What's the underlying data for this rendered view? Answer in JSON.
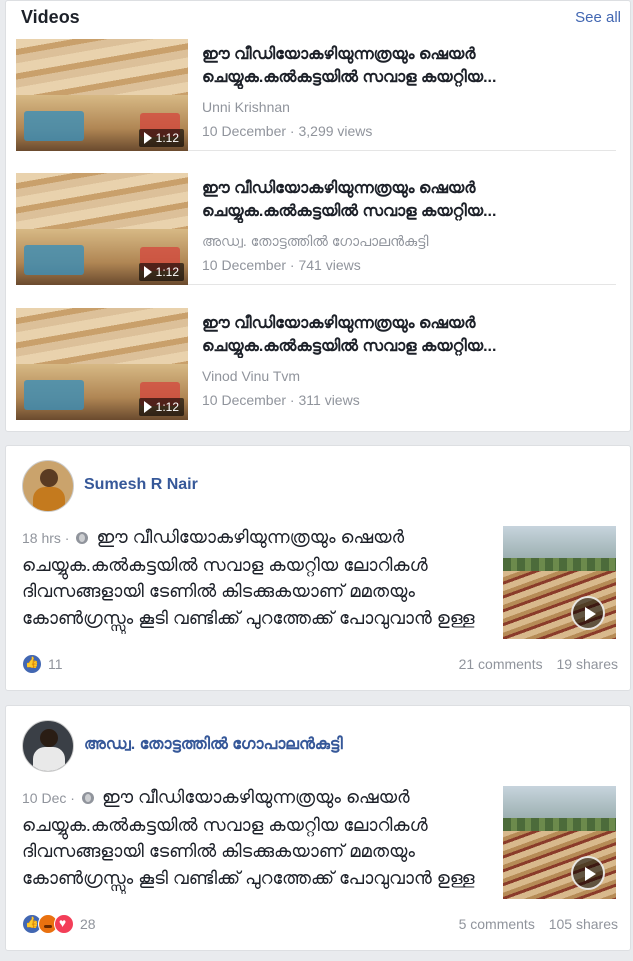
{
  "videos": {
    "title": "Videos",
    "see_all": "See all",
    "items": [
      {
        "title": "ഈ വീഡിയോകഴിയുന്നത്രയും ഷെയർ ചെയ്യുക.കൽകട്ടയിൽ സവാള കയറ്റിയ...",
        "author": "Unni Krishnan",
        "meta": "10 December · 3,299 views",
        "duration": "1:12"
      },
      {
        "title": "ഈ വീഡിയോകഴിയുന്നത്രയും ഷെയർ ചെയ്യുക.കൽകട്ടയിൽ സവാള കയറ്റിയ...",
        "author": "അഡ്വ. തോട്ടത്തിൽ ഗോപാലൻകുട്ടി",
        "meta": "10 December · 741 views",
        "duration": "1:12"
      },
      {
        "title": "ഈ വീഡിയോകഴിയുന്നത്രയും ഷെയർ ചെയ്യുക.കൽകട്ടയിൽ സവാള കയറ്റിയ...",
        "author": "Vinod Vinu Tvm",
        "meta": "10 December · 311 views",
        "duration": "1:12"
      }
    ]
  },
  "posts": [
    {
      "author": "Sumesh R Nair",
      "time": "18 hrs ·",
      "text": "ഈ വീഡിയോകഴിയുന്നത്രയും ഷെയർ ചെയ്യുക.കൽകട്ടയിൽ സവാള കയറ്റിയ ലോറികൾ ദിവസങ്ങളായി ടേണിൽ കിടക്കുകയാണ് മമതയും കോൺഗ്രസ്സും കൂടി വണ്ടിക്ക് പുറത്തേക്ക് പോവുവാൻ ഉള്ള പാസ് കൊടുക്കുന്നില്ല. സവാള...",
      "reactions_count": "11",
      "comments": "21 comments",
      "shares": "19 shares"
    },
    {
      "author": "അഡ്വ. തോട്ടത്തിൽ ഗോപാലൻകുട്ടി",
      "time": "10 Dec ·",
      "text": "ഈ വീഡിയോകഴിയുന്നത്രയും ഷെയർ ചെയ്യുക.കൽകട്ടയിൽ സവാള കയറ്റിയ ലോറികൾ ദിവസങ്ങളായി ടേണിൽ കിടക്കുകയാണ് മമതയും കോൺഗ്രസ്സും കൂടി വണ്ടിക്ക് പുറത്തേക്ക് പോവുവാൻ ഉള്ള പാസ് കൊടുക്കുന്നില്ല. സവാള...",
      "reactions_count": "28",
      "comments": "5 comments",
      "shares": "105 shares"
    }
  ],
  "colors": {
    "link": "#4267b2",
    "name": "#365899",
    "meta": "#90949c",
    "background": "#e9ebee"
  },
  "icons": {
    "reactions_post1": [
      "like-icon"
    ],
    "reactions_post2": [
      "like-icon",
      "angry-icon",
      "love-icon"
    ]
  }
}
